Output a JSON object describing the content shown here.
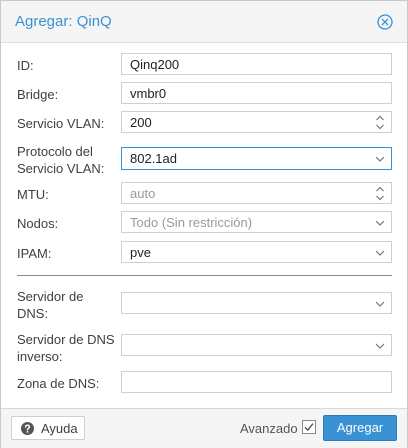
{
  "dialog": {
    "title": "Agregar: QinQ",
    "close_icon": "close-circle-icon",
    "accent_color": "#3892d4"
  },
  "fields": {
    "id": {
      "label": "ID:",
      "value": "Qinq200"
    },
    "bridge": {
      "label": "Bridge:",
      "value": "vmbr0"
    },
    "vlan": {
      "label": "Servicio VLAN:",
      "value": "200"
    },
    "protocol": {
      "label_line1": "Protocolo del",
      "label_line2": "Servicio VLAN:",
      "value": "802.1ad"
    },
    "mtu": {
      "label": "MTU:",
      "placeholder": "auto"
    },
    "nodes": {
      "label": "Nodos:",
      "placeholder": "Todo (Sin restricción)"
    },
    "ipam": {
      "label": "IPAM:",
      "value": "pve"
    },
    "dns": {
      "label_line1": "Servidor de",
      "label_line2": "DNS:",
      "value": ""
    },
    "reverse_dns": {
      "label_line1": "Servidor de DNS",
      "label_line2": "inverso:",
      "value": ""
    },
    "dns_zone": {
      "label": "Zona de DNS:",
      "value": ""
    }
  },
  "footer": {
    "help_label": "Ayuda",
    "help_icon": "question-circle-icon",
    "advanced_label": "Avanzado",
    "advanced_checked": true,
    "add_label": "Agregar"
  }
}
